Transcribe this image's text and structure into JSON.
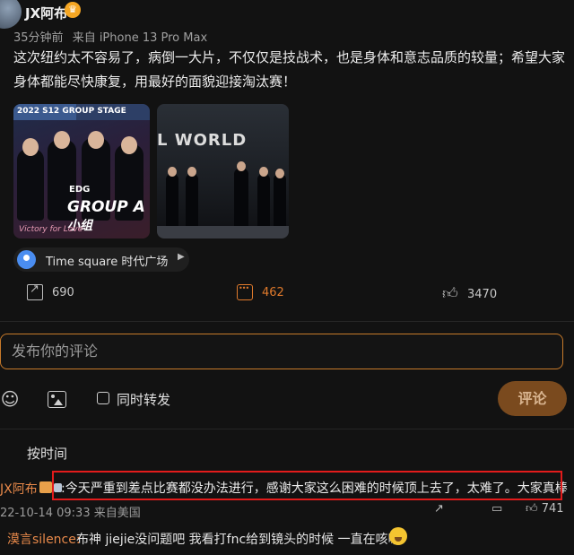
{
  "post": {
    "username": "JX阿布",
    "time": "35分钟前",
    "source": "来自 iPhone 13 Pro Max",
    "text": "这次纽约太不容易了，病倒一大片，不仅仅是技战术，也是身体和意志品质的较量；希望大家身体都能尽快康复，用最好的面貌迎接淘汰赛！",
    "image1": {
      "caption": "2022 S12 GROUP STAGE",
      "team": "EDG",
      "group_text": "GROUP A",
      "group_suffix": "小组",
      "tagline": "Victory for Love"
    },
    "image2": {
      "wall_text": "L WORLD"
    },
    "location": "Time square 时代广场",
    "shares": "690",
    "comments": "462",
    "likes": "3470"
  },
  "composer": {
    "placeholder": "发布你的评论",
    "repost_label": "同时转发",
    "submit_label": "评论"
  },
  "comments_section": {
    "sort_label": "按时间",
    "top_comment": {
      "user": "JX阿布",
      "text": ":今天严重到差点比赛都没办法进行，感谢大家这么困难的时候顶上去了，太难了。大家真棒",
      "date": "22-10-14 09:33",
      "source": "来自美国",
      "likes": "741"
    },
    "reply": {
      "user": "漠言silence:",
      "text": "布神 jiejie没问题吧 我看打fnc给到镜头的时候 一直在咳嗽"
    }
  },
  "colors": {
    "accent": "#e07a2c",
    "highlight_box": "#e21b1b",
    "background": "#121212"
  }
}
